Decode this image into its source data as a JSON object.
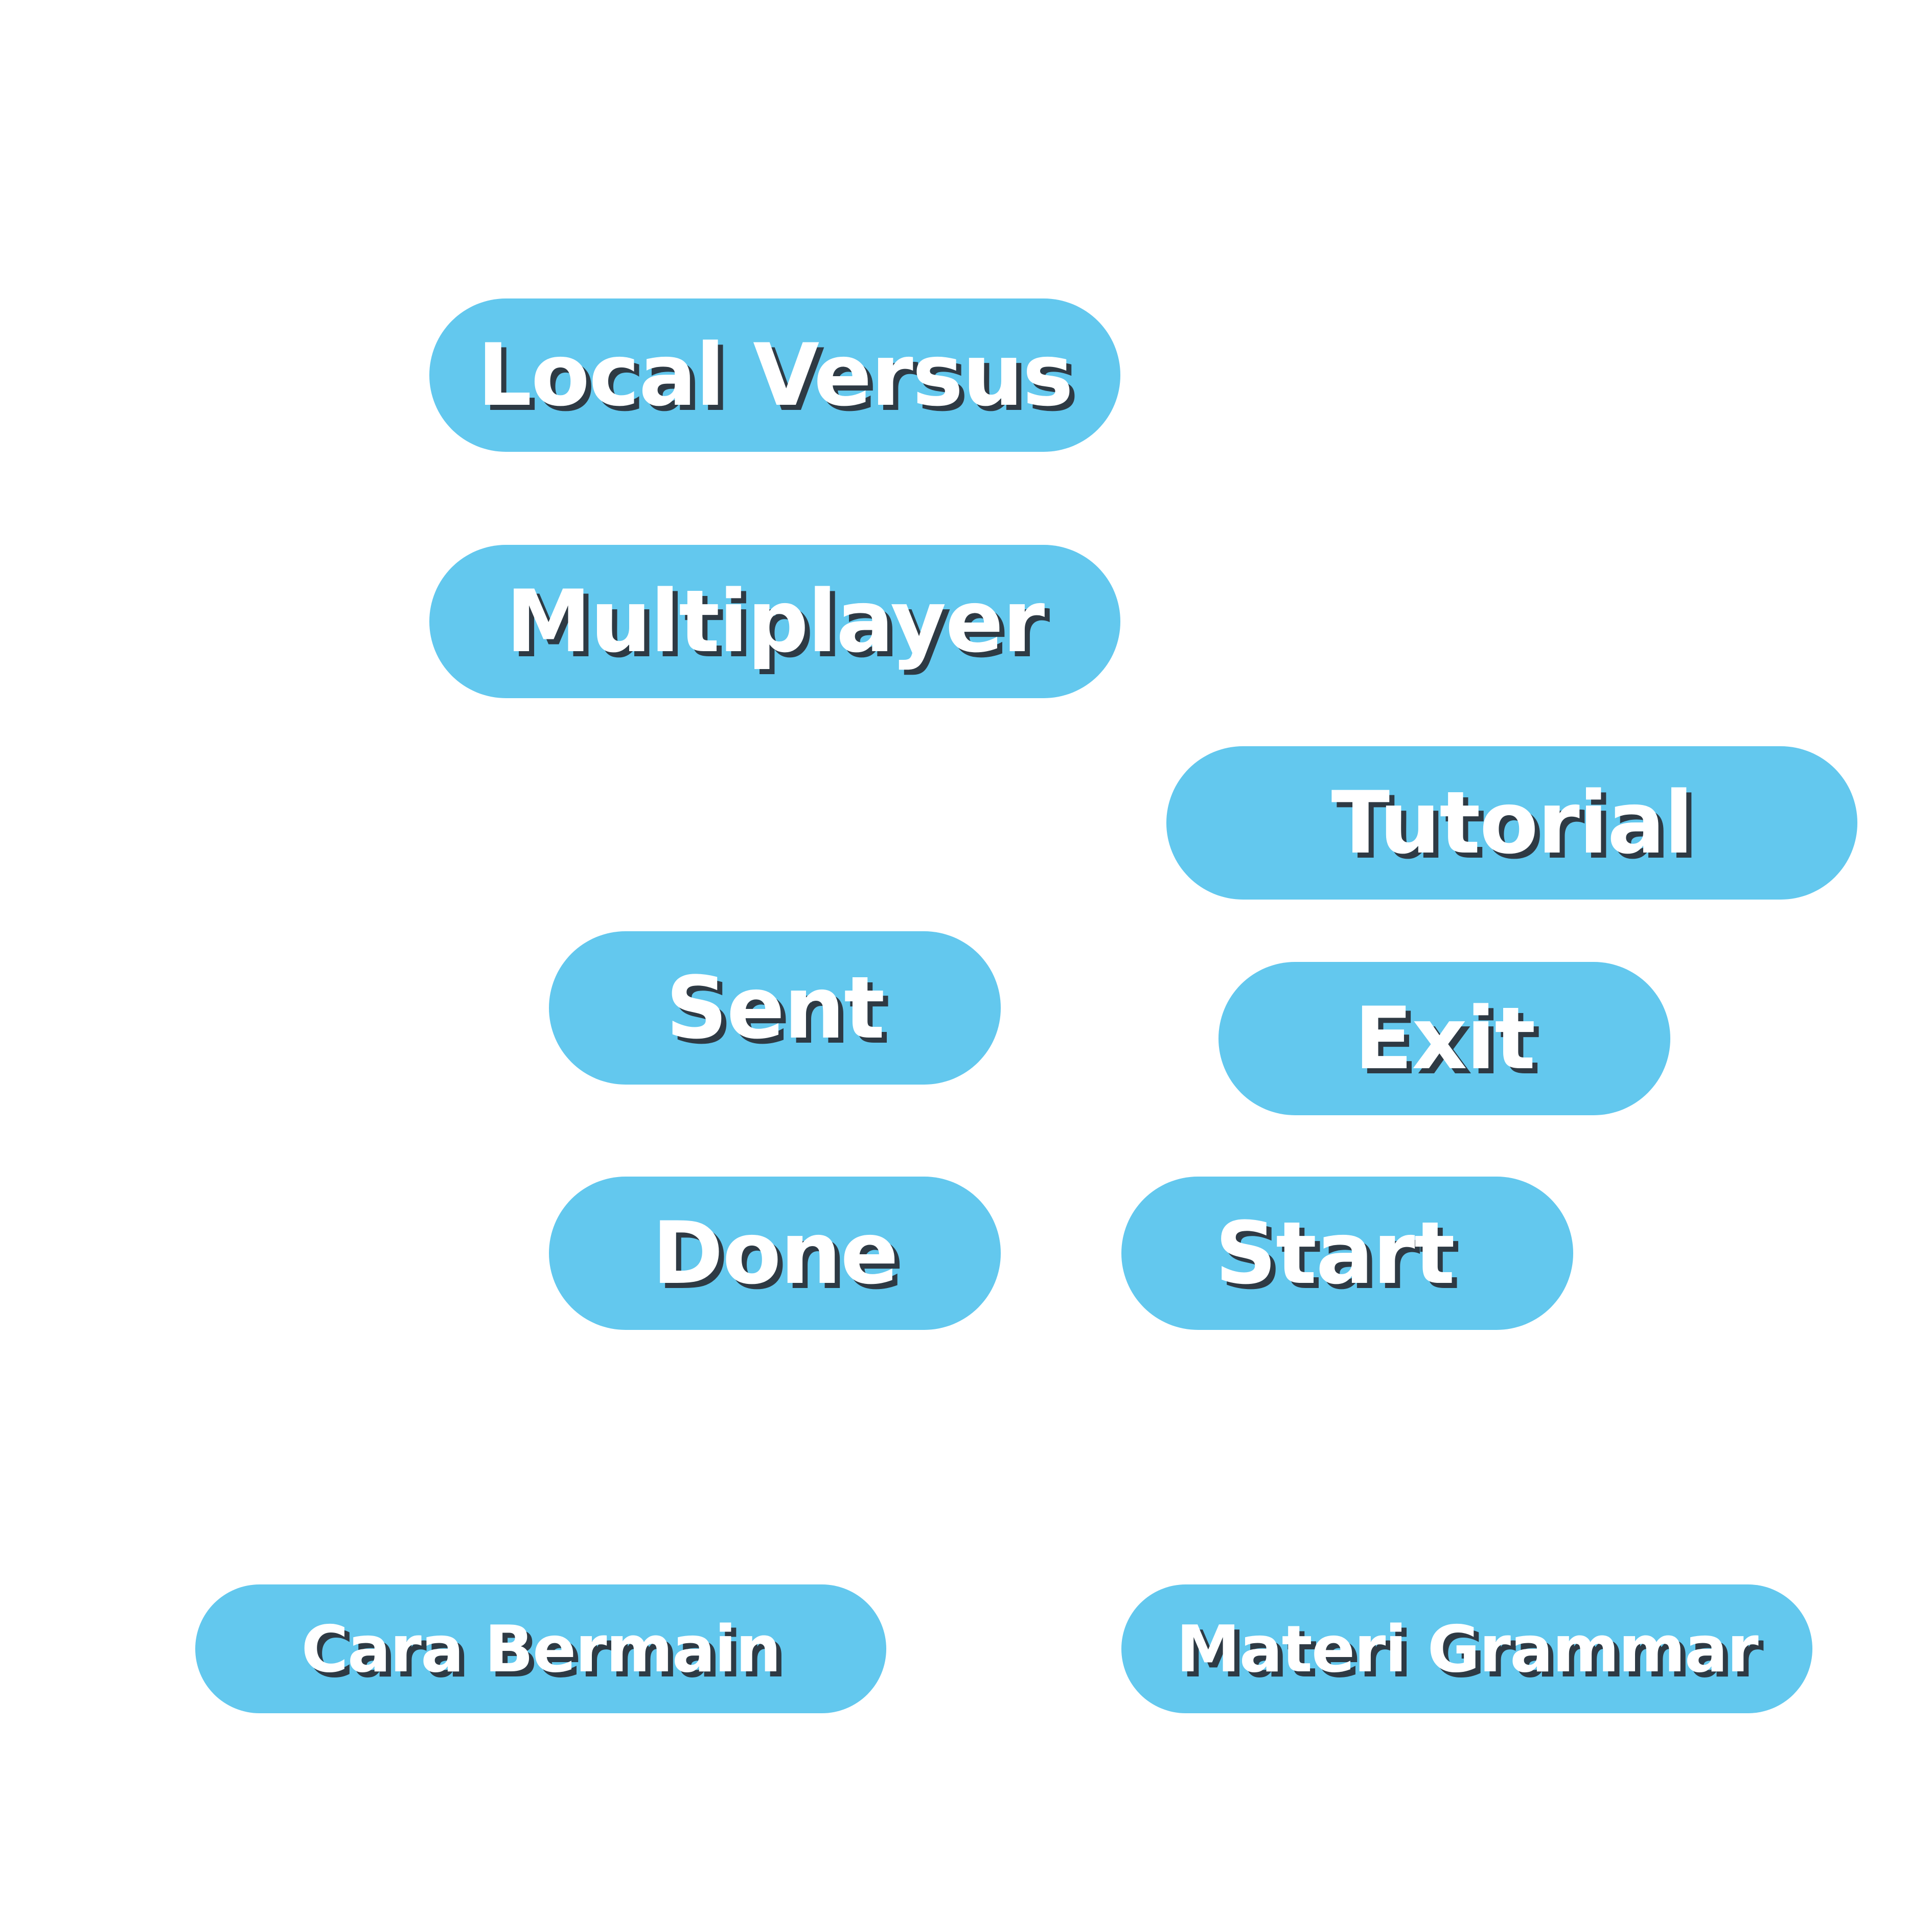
{
  "buttons": {
    "local_versus": "Local Versus",
    "multiplayer": "Multiplayer",
    "tutorial": "Tutorial",
    "sent": "Sent",
    "exit": "Exit",
    "done": "Done",
    "start": "Start",
    "cara_bermain": "Cara Bermain",
    "materi_grammar": "Materi Grammar"
  },
  "colors": {
    "button_fill": "#63c8ee",
    "text": "#ffffff",
    "text_shadow": "#2e3a44",
    "background": "#ffffff"
  }
}
